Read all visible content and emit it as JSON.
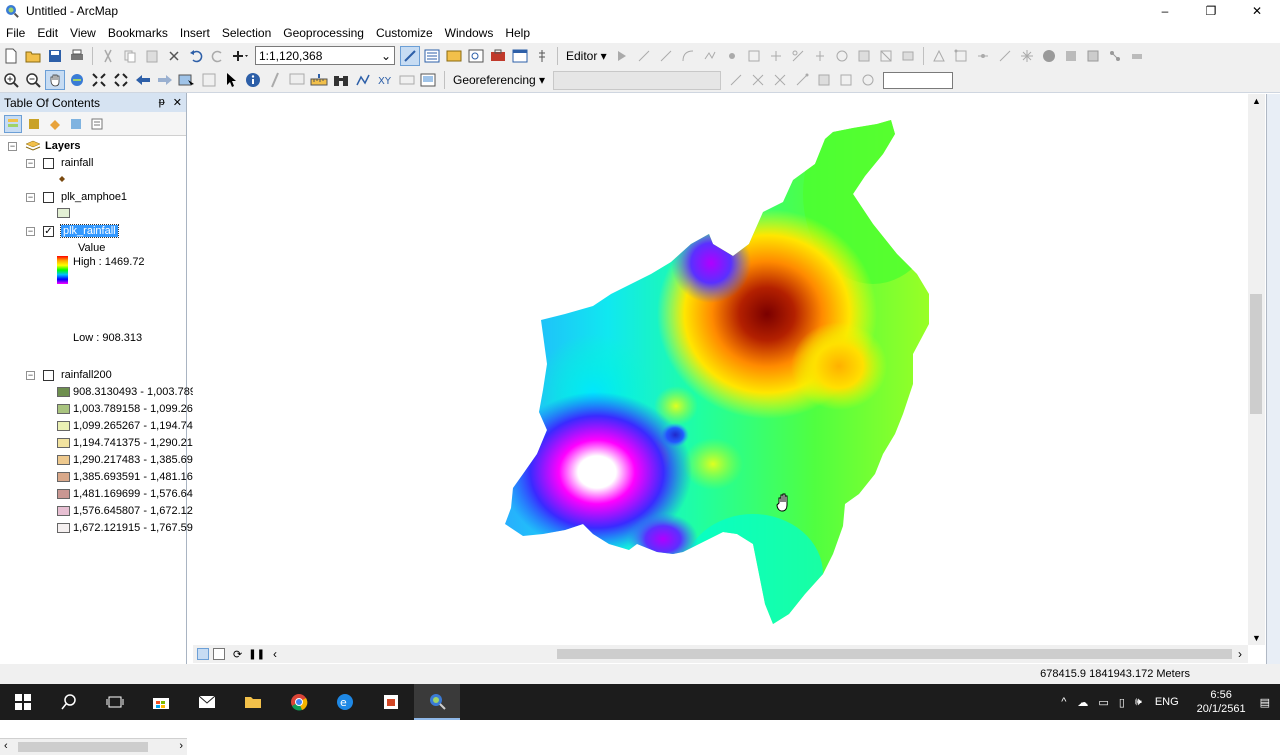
{
  "window": {
    "title": "Untitled - ArcMap",
    "minimize": "–",
    "maximize": "❐",
    "close": "✕"
  },
  "menu": [
    "File",
    "Edit",
    "View",
    "Bookmarks",
    "Insert",
    "Selection",
    "Geoprocessing",
    "Customize",
    "Windows",
    "Help"
  ],
  "toolbar": {
    "scale_value": "1:1,120,368",
    "editor_label": "Editor ▾",
    "georef_label": "Georeferencing ▾"
  },
  "toc": {
    "title": "Table Of Contents",
    "pin": "ᵽ",
    "close": "✕",
    "group_label": "Layers",
    "layers": [
      {
        "name": "rainfall",
        "checked": false
      },
      {
        "name": "plk_amphoe1",
        "checked": false
      },
      {
        "name": "plk_rainfall",
        "checked": true
      },
      {
        "name": "rainfall200",
        "checked": false
      }
    ],
    "raster_legend": {
      "field": "Value",
      "high": "High : 1469.72",
      "low": "Low : 908.313"
    },
    "classes": [
      {
        "label": "908.3130493 - 1,003.789",
        "color": "#6e8f4f"
      },
      {
        "label": "1,003.789158 - 1,099.26",
        "color": "#a9c47f"
      },
      {
        "label": "1,099.265267 - 1,194.74",
        "color": "#eaf0b4"
      },
      {
        "label": "1,194.741375 - 1,290.21",
        "color": "#f2e3a0"
      },
      {
        "label": "1,290.217483 - 1,385.69",
        "color": "#eec98e"
      },
      {
        "label": "1,385.693591 - 1,481.16",
        "color": "#d9a88a"
      },
      {
        "label": "1,481.169699 - 1,576.64",
        "color": "#c99792"
      },
      {
        "label": "1,576.645807 - 1,672.12",
        "color": "#e7bfd2"
      },
      {
        "label": "1,672.121915 - 1,767.59",
        "color": "#f5f0f0"
      }
    ]
  },
  "status": {
    "coords": "678415.9  1841943.172 Meters"
  },
  "taskbar": {
    "lang": "ENG",
    "time": "6:56",
    "date": "20/1/2561"
  },
  "colors": {
    "toc_header": "#d6e3f2",
    "selection": "#3399ff",
    "taskbar": "#1c1c1c"
  }
}
